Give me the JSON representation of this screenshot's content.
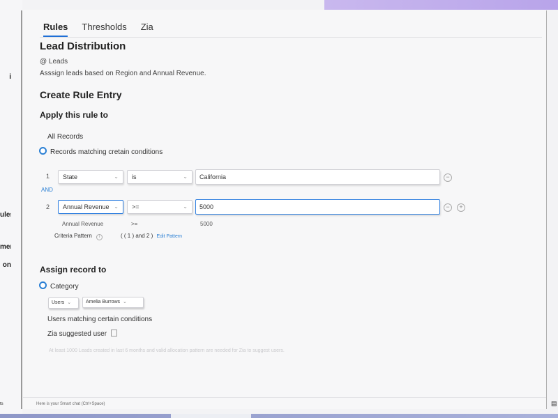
{
  "tabs": [
    "Rules",
    "Thresholds",
    "Zia"
  ],
  "left_rail": {
    "item1": "ules",
    "item2": "ment",
    "item3": "on",
    "footer": "ts"
  },
  "rule": {
    "title": "Lead Distribution",
    "module": "@ Leads",
    "description": "Asssign leads based on Region and Annual Revenue."
  },
  "create_rule_title": "Create Rule Entry",
  "apply": {
    "heading": "Apply this rule to",
    "option_all": "All Records",
    "option_matching": "Records matching cretain conditions"
  },
  "conditions": [
    {
      "num": "1",
      "field": "State",
      "operator": "is",
      "value": "California"
    },
    {
      "num": "2",
      "field": "Annual Revenue",
      "operator": ">=",
      "value": "5000"
    }
  ],
  "and_label": "AND",
  "preview": {
    "field": "Annual Revenue",
    "operator": ">=",
    "value": "5000"
  },
  "criteria": {
    "label": "Criteria Pattern",
    "pattern": "( ( 1 ) and 2 )",
    "edit_link": "Edit Pattern"
  },
  "assign": {
    "heading": "Assign record to",
    "option_category": "Category",
    "users_select": "Users",
    "user_chip": "Amelia Burrows",
    "option_matching_users": "Users matching certain conditions",
    "option_zia": "Zia suggested user",
    "zia_note": "At least 1000 Leads created in last 6 months and valid allocation pattern are needed for Zia to suggest users."
  },
  "footer_text": "Here is your Smart chat (Ctrl+Space)",
  "colors": {
    "accent": "#2a7fd4",
    "focus_border": "#2f7fe0"
  }
}
